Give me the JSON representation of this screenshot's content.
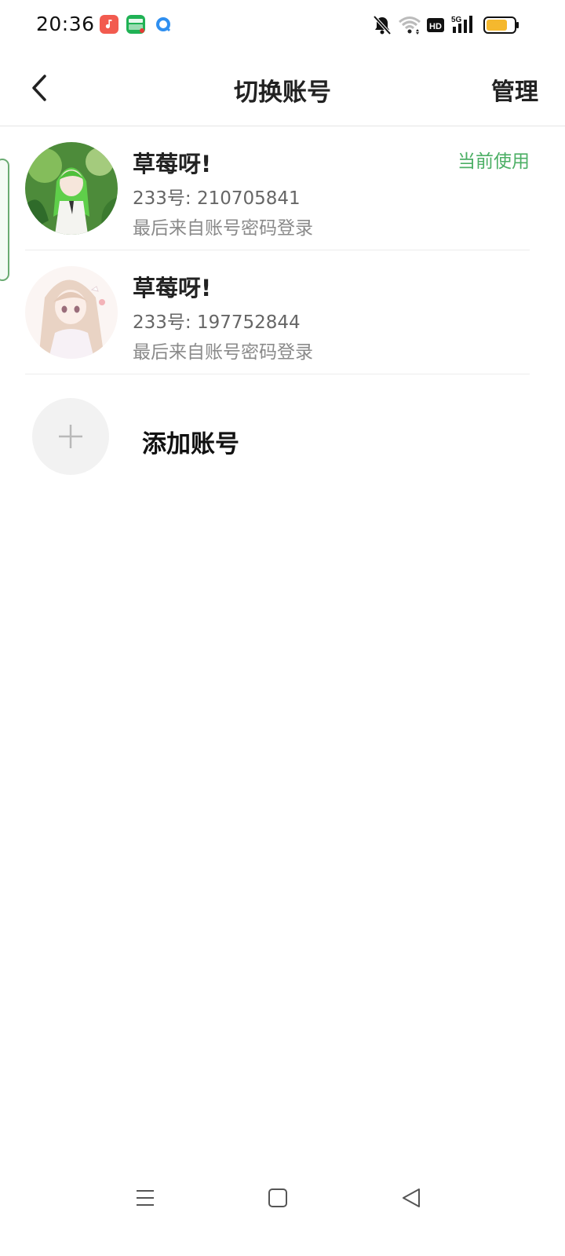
{
  "status_bar": {
    "time": "20:36",
    "apps": [
      "music-app-icon",
      "iqiyi-app-icon",
      "browser-app-icon"
    ],
    "indicators": [
      "bell-muted-icon",
      "wifi-icon",
      "hd-icon",
      "5g-signal-icon",
      "battery-icon"
    ],
    "signal_label": "5G",
    "hd_label": "HD",
    "battery_color": "#f5b82e"
  },
  "header": {
    "title": "切换账号",
    "manage_label": "管理",
    "back_icon": "chevron-left-icon"
  },
  "accounts": [
    {
      "name": "草莓呀!",
      "uid": "233号: 210705841",
      "login_source": "最后来自账号密码登录",
      "badge": "当前使用"
    },
    {
      "name": "草莓呀!",
      "uid": "233号: 197752844",
      "login_source": "最后来自账号密码登录",
      "badge": ""
    }
  ],
  "add_account": {
    "label": "添加账号",
    "icon": "plus-icon"
  },
  "nav_bar": {
    "items": [
      "menu-icon",
      "home-square-icon",
      "back-triangle-icon"
    ]
  },
  "colors": {
    "accent_green": "#4caf65",
    "divider": "#ececec"
  }
}
